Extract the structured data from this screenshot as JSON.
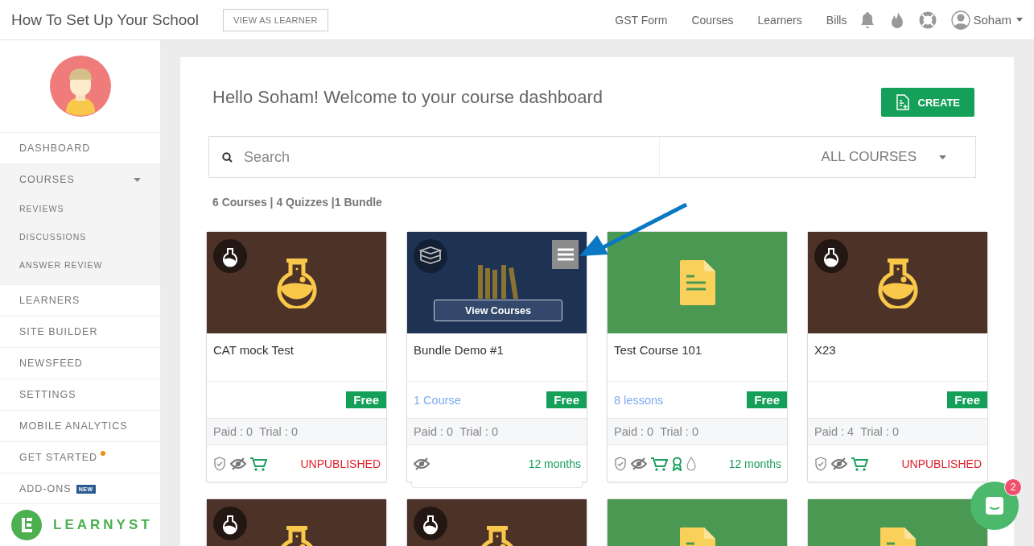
{
  "header": {
    "title": "How To Set Up Your School",
    "view_button": "VIEW AS LEARNER",
    "nav": [
      "GST Form",
      "Courses",
      "Learners",
      "Bills"
    ],
    "user": "Soham"
  },
  "sidebar": {
    "items": [
      {
        "label": "DASHBOARD",
        "expanded": false,
        "dot": false
      },
      {
        "label": "COURSES",
        "expanded": true,
        "dot": false,
        "children": [
          {
            "label": "REVIEWS"
          },
          {
            "label": "DISCUSSIONS"
          },
          {
            "label": "ANSWER REVIEW"
          }
        ]
      },
      {
        "label": "LEARNERS",
        "expanded": false,
        "dot": false
      },
      {
        "label": "SITE BUILDER",
        "expanded": false,
        "dot": false
      },
      {
        "label": "NEWSFEED",
        "expanded": false,
        "dot": false
      },
      {
        "label": "SETTINGS",
        "expanded": false,
        "dot": false
      },
      {
        "label": "MOBILE ANALYTICS",
        "expanded": false,
        "dot": false
      },
      {
        "label": "GET STARTED",
        "expanded": false,
        "dot": true
      },
      {
        "label": "ADD-ONS",
        "expanded": false,
        "dot": false,
        "badge": "NEW"
      }
    ],
    "brand": "LEARNYST"
  },
  "main": {
    "greeting": "Hello Soham! Welcome to your course dashboard",
    "create_button": "CREATE",
    "search": {
      "placeholder": "Search"
    },
    "filter": "ALL COURSES",
    "summary": "6 Courses | 4 Quizzes |1 Bundle",
    "cards": [
      {
        "kind": "quiz",
        "title": "CAT mock Test",
        "price": "Free",
        "paid": "Paid : 0",
        "trial": "Trial : 0",
        "footer_icons": [
          {
            "kind": "shield"
          },
          {
            "kind": "hidden"
          },
          {
            "kind": "cart"
          }
        ],
        "status": {
          "kind": "unpublished",
          "text": "UNPUBLISHED"
        }
      },
      {
        "kind": "bundle",
        "title": "Bundle Demo #1",
        "link": "1 Course",
        "action": "View Courses",
        "price": "Free",
        "paid": "Paid : 0",
        "trial": "Trial : 0",
        "footer_icons": [
          {
            "kind": "hidden"
          }
        ],
        "status": {
          "kind": "validity",
          "text": "12 months"
        }
      },
      {
        "kind": "course",
        "title": "Test Course 101",
        "link": "8 lessons",
        "price": "Free",
        "paid": "Paid : 0",
        "trial": "Trial : 0",
        "footer_icons": [
          {
            "kind": "shield"
          },
          {
            "kind": "hidden"
          },
          {
            "kind": "cart"
          },
          {
            "kind": "award"
          },
          {
            "kind": "drop"
          }
        ],
        "status": {
          "kind": "validity",
          "text": "12 months"
        }
      },
      {
        "kind": "quiz",
        "title": "X23",
        "price": "Free",
        "paid": "Paid : 4",
        "trial": "Trial : 0",
        "footer_icons": [
          {
            "kind": "shield"
          },
          {
            "kind": "hidden"
          },
          {
            "kind": "cart"
          }
        ],
        "status": {
          "kind": "unpublished",
          "text": "UNPUBLISHED"
        }
      },
      {
        "kind": "quiz"
      },
      {
        "kind": "quiz"
      },
      {
        "kind": "course"
      },
      {
        "kind": "course"
      }
    ]
  },
  "chat": {
    "count": "2"
  }
}
